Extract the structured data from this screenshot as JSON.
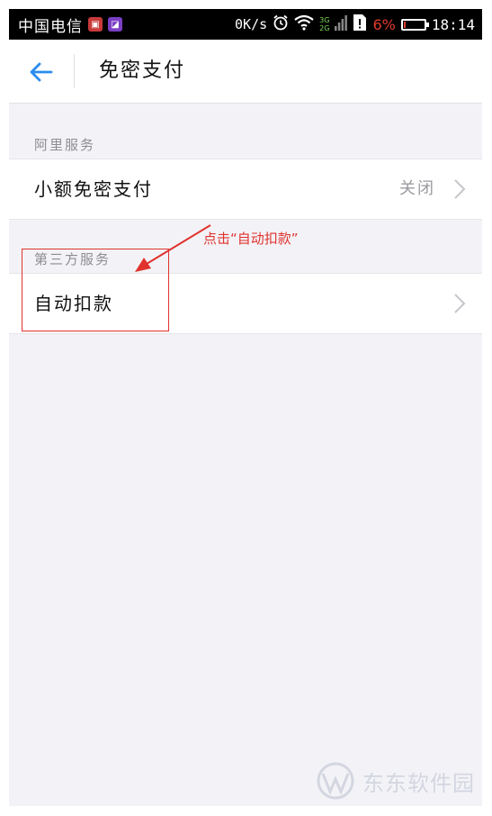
{
  "status_bar": {
    "carrier": "中国电信",
    "net_speed": "0K/s",
    "signal_3g": "3G",
    "signal_2g": "2G",
    "battery_percent": "6%",
    "battery_level": 0.06,
    "time": "18:14"
  },
  "header": {
    "title": "免密支付"
  },
  "sections": {
    "ali": {
      "label": "阿里服务",
      "row": {
        "label": "小额免密支付",
        "value": "关闭"
      }
    },
    "third": {
      "label": "第三方服务",
      "row": {
        "label": "自动扣款"
      }
    }
  },
  "annotation": {
    "text": "点击“自动扣款”",
    "color": "#e0322d"
  },
  "watermark": {
    "text": "东东软件园"
  },
  "colors": {
    "accent": "#2a8cf0",
    "background": "#f3f3f7"
  }
}
